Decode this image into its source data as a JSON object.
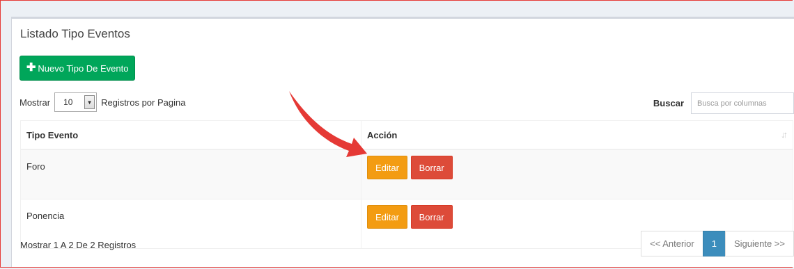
{
  "title": "Listado Tipo Eventos",
  "new_button": {
    "label": "Nuevo Tipo De Evento",
    "icon": "plus-icon"
  },
  "length": {
    "prefix": "Mostrar",
    "value": "10",
    "suffix": "Registros por Pagina"
  },
  "search": {
    "label": "Buscar",
    "placeholder": "Busca por columnas"
  },
  "table": {
    "headers": [
      "Tipo Evento",
      "Acción"
    ],
    "rows": [
      {
        "name": "Foro",
        "edit": "Editar",
        "delete": "Borrar"
      },
      {
        "name": "Ponencia",
        "edit": "Editar",
        "delete": "Borrar"
      }
    ]
  },
  "info": "Mostrar 1 A 2 De 2 Registros",
  "pagination": {
    "prev": "<< Anterior",
    "current": "1",
    "next": "Siguiente >>"
  },
  "colors": {
    "green": "#00a65a",
    "orange": "#f39c12",
    "red": "#dd4b39",
    "blue": "#3c8dbc",
    "annotation": "#e53935"
  }
}
